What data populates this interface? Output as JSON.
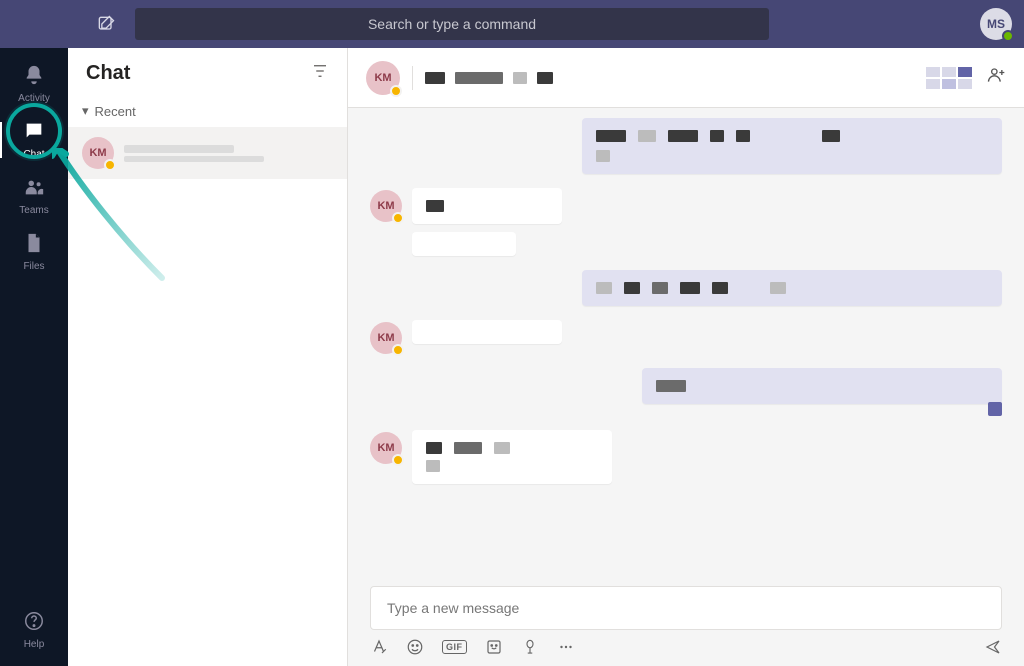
{
  "titlebar": {
    "search_placeholder": "Search or type a command",
    "profile_initials": "MS"
  },
  "nav": {
    "activity": "Activity",
    "chat": "Chat",
    "teams": "Teams",
    "files": "Files",
    "help": "Help"
  },
  "chat_panel": {
    "title": "Chat",
    "recent_label": "Recent",
    "items": [
      {
        "initials": "KM",
        "status": "away"
      }
    ]
  },
  "conversation": {
    "header_initials": "KM",
    "header_status": "away"
  },
  "compose": {
    "placeholder": "Type a new message",
    "gif_label": "GIF"
  },
  "colors": {
    "titlebar": "#464775",
    "accent": "#6264a7",
    "outgoing_bubble": "#e1e1f1",
    "annotation_highlight": "#0aa89e"
  }
}
